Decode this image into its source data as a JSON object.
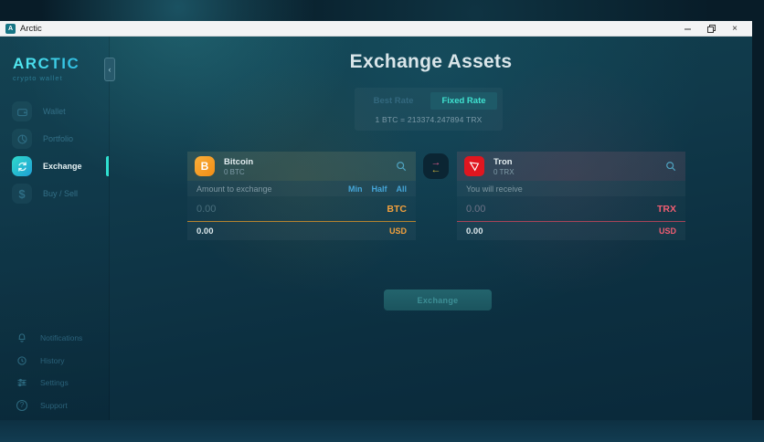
{
  "titlebar": {
    "icon_letter": "A",
    "title": "Arctic"
  },
  "sidebar": {
    "logo": "ARCTIC",
    "logo_subtitle": "crypto wallet",
    "collapse_icon": "‹",
    "main_items": [
      {
        "label": "Wallet",
        "icon": "wallet-icon",
        "active": false
      },
      {
        "label": "Portfolio",
        "icon": "portfolio-icon",
        "active": false
      },
      {
        "label": "Exchange",
        "icon": "exchange-icon",
        "active": true
      },
      {
        "label": "Buy / Sell",
        "icon": "buy-sell-icon",
        "active": false
      }
    ],
    "footer_items": [
      {
        "label": "Notifications",
        "icon": "bell-icon"
      },
      {
        "label": "History",
        "icon": "history-icon"
      },
      {
        "label": "Settings",
        "icon": "settings-icon"
      },
      {
        "label": "Support",
        "icon": "support-icon"
      }
    ]
  },
  "main": {
    "title": "Exchange Assets",
    "tabs": [
      {
        "label": "Best Rate",
        "active": false
      },
      {
        "label": "Fixed Rate",
        "active": true
      }
    ],
    "rate": "1 BTC = 213374.247894 TRX",
    "from_panel": {
      "asset_name": "Bitcoin",
      "asset_balance": "0 BTC",
      "row_label": "Amount to exchange",
      "quick_buttons": [
        "Min",
        "Half",
        "All"
      ],
      "amount_placeholder": "0.00",
      "currency": "BTC",
      "fiat_value": "0.00",
      "fiat_currency": "USD",
      "accent_color": "#f7931a"
    },
    "to_panel": {
      "asset_name": "Tron",
      "asset_balance": "0 TRX",
      "row_label": "You will receive",
      "amount_placeholder": "0.00",
      "currency": "TRX",
      "fiat_value": "0.00",
      "fiat_currency": "USD",
      "accent_color": "#ef4b60"
    },
    "exchange_button": "Exchange"
  },
  "colors": {
    "accent_cyan": "#2fe0d0",
    "bitcoin_orange": "#f7931a",
    "tron_red": "#e0161f",
    "titlebar_bg": "#f2f3f4"
  }
}
